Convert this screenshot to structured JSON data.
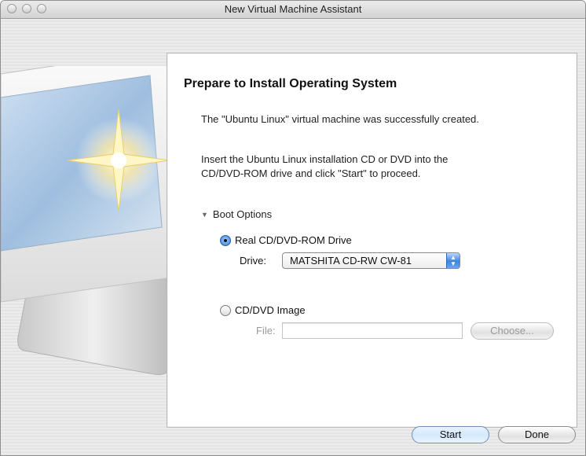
{
  "window": {
    "title": "New Virtual Machine Assistant"
  },
  "main": {
    "heading": "Prepare to Install Operating System",
    "success_message": "The \"Ubuntu Linux\" virtual machine was successfully created.",
    "instruction_line1": "Insert the Ubuntu Linux installation CD or DVD into the",
    "instruction_line2": "CD/DVD-ROM drive and click \"Start\" to proceed.",
    "boot_options": {
      "label": "Boot Options",
      "expanded": true,
      "real_drive": {
        "label": "Real CD/DVD-ROM Drive",
        "selected": true,
        "drive_label": "Drive:",
        "drive_value": "MATSHITA CD-RW  CW-81"
      },
      "image": {
        "label": "CD/DVD Image",
        "selected": false,
        "file_label": "File:",
        "file_value": "",
        "choose_label": "Choose..."
      }
    }
  },
  "footer": {
    "start_label": "Start",
    "done_label": "Done"
  }
}
